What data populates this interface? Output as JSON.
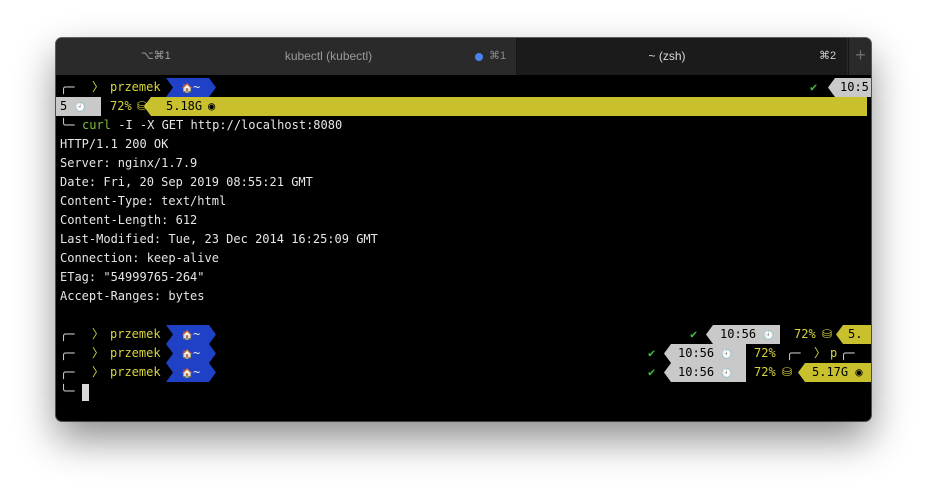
{
  "window": {
    "tabs": [
      {
        "shortcut_left": "⌥⌘1",
        "title": "kubectl (kubectl)",
        "shortcut_right": "⌘1"
      },
      {
        "title": "~ (zsh)",
        "shortcut_right": "⌘2"
      }
    ],
    "new_tab_symbol": "+"
  },
  "prompt": {
    "user": "przemek",
    "dir": "~",
    "home_icon": "🏠",
    "apple_icon": "",
    "frame_top": "╭─",
    "frame_bottom": "╰─",
    "separator": "〉"
  },
  "status": {
    "check": "✔",
    "time_partial": "10:5",
    "time": "10:56",
    "clock_icon": "🕘",
    "battery": "72%",
    "disk_icon": "⛁",
    "mem_first": "5.18G",
    "mem_last": "5.17G",
    "gauge_icon": "◉",
    "wrapped_prefix": "5",
    "mem_partial": "5.",
    "wrap_p": "p"
  },
  "command": {
    "program": "curl",
    "args": " -I -X GET http://localhost:8080"
  },
  "output": [
    "HTTP/1.1 200 OK",
    "Server: nginx/1.7.9",
    "Date: Fri, 20 Sep 2019 08:55:21 GMT",
    "Content-Type: text/html",
    "Content-Length: 612",
    "Last-Modified: Tue, 23 Dec 2014 16:25:09 GMT",
    "Connection: keep-alive",
    "ETag: \"54999765-264\"",
    "Accept-Ranges: bytes"
  ]
}
